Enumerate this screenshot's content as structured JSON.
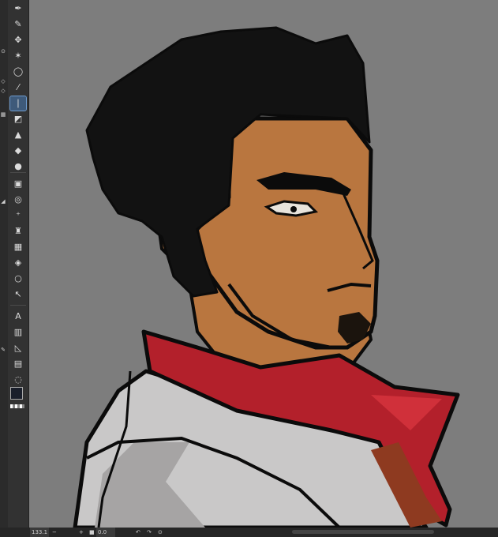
{
  "status": {
    "zoom": "133.1",
    "rotation": "0.0"
  },
  "tools": [
    {
      "name": "pen-tool-icon",
      "glyph": "✒"
    },
    {
      "name": "eraser-pencil-icon",
      "glyph": "✎"
    },
    {
      "name": "move-icon",
      "glyph": "✥"
    },
    {
      "name": "auto-select-icon",
      "glyph": "✶"
    },
    {
      "name": "lasso-icon",
      "glyph": "◯"
    },
    {
      "name": "eyedropper-icon",
      "glyph": "⁄"
    },
    {
      "name": "brush-icon",
      "glyph": "❘"
    },
    {
      "name": "airbrush-icon",
      "glyph": "◩"
    },
    {
      "name": "paint-icon",
      "glyph": "▲"
    },
    {
      "name": "eraser-icon",
      "glyph": "◆"
    },
    {
      "name": "blend-icon",
      "glyph": "●"
    },
    {
      "name": "fill-icon",
      "glyph": "▣"
    },
    {
      "name": "liquify-icon",
      "glyph": "◎"
    },
    {
      "name": "spray-icon",
      "glyph": "⁺"
    },
    {
      "name": "bucket-icon",
      "glyph": "♜"
    },
    {
      "name": "gradient-icon",
      "glyph": "▦"
    },
    {
      "name": "shape-icon",
      "glyph": "◈"
    },
    {
      "name": "ellipse-icon",
      "glyph": "○"
    },
    {
      "name": "operation-icon",
      "glyph": "↖"
    },
    {
      "name": "text-icon",
      "glyph": "A"
    },
    {
      "name": "frame-icon",
      "glyph": "▥"
    },
    {
      "name": "ruler-icon",
      "glyph": "◺"
    },
    {
      "name": "panel-icon",
      "glyph": "▤"
    },
    {
      "name": "balloon-icon",
      "glyph": "◌"
    }
  ],
  "colors": {
    "background": "#7d7d7d",
    "hair": "#121212",
    "skin": "#b9763f",
    "skin_shadow": "#9b5e2c",
    "collar": "#b3202b",
    "collar_light": "#d0303a",
    "coat": "#c9c8c8",
    "coat_shadow": "#a6a4a4",
    "line": "#0b0b0b"
  }
}
